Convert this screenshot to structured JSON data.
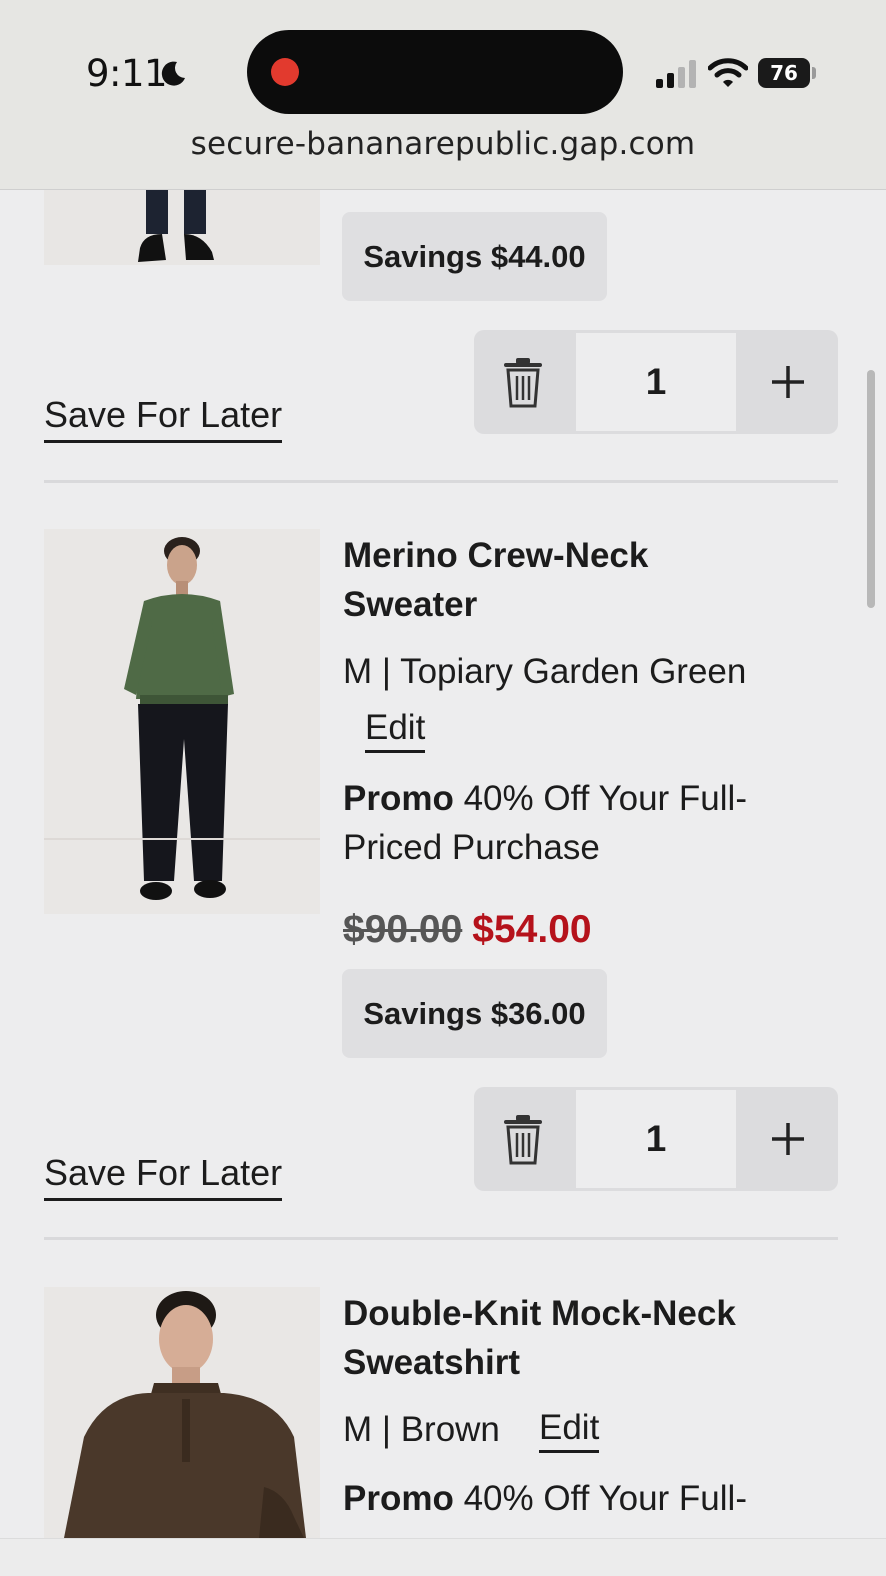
{
  "status_bar": {
    "time": "9:11",
    "battery": "76"
  },
  "browser": {
    "url": "secure-bananarepublic.gap.com"
  },
  "cart": {
    "item1": {
      "savings": "Savings $44.00",
      "quantity": "1",
      "save_for_later": "Save For Later"
    },
    "item2": {
      "title_line1": "Merino Crew-Neck",
      "title_line2": "Sweater",
      "variant": "M | Topiary Garden Green",
      "edit": "Edit",
      "promo_label": "Promo",
      "promo_text_line1": " 40% Off Your Full-",
      "promo_text_line2": "Priced Purchase",
      "original_price": "$90.00",
      "sale_price": "$54.00",
      "savings": "Savings $36.00",
      "quantity": "1",
      "save_for_later": "Save For Later",
      "image_alt": "Model wearing green sweater"
    },
    "item3": {
      "title_line1": "Double-Knit Mock-Neck",
      "title_line2": "Sweatshirt",
      "variant": "M | Brown",
      "edit": "Edit",
      "promo_label": "Promo",
      "promo_text_line1": " 40% Off Your Full-",
      "image_alt": "Model wearing brown mock-neck sweatshirt"
    }
  },
  "colors": {
    "sale": "#b5121b",
    "background": "#ededee",
    "chip": "#dfdfe1"
  }
}
